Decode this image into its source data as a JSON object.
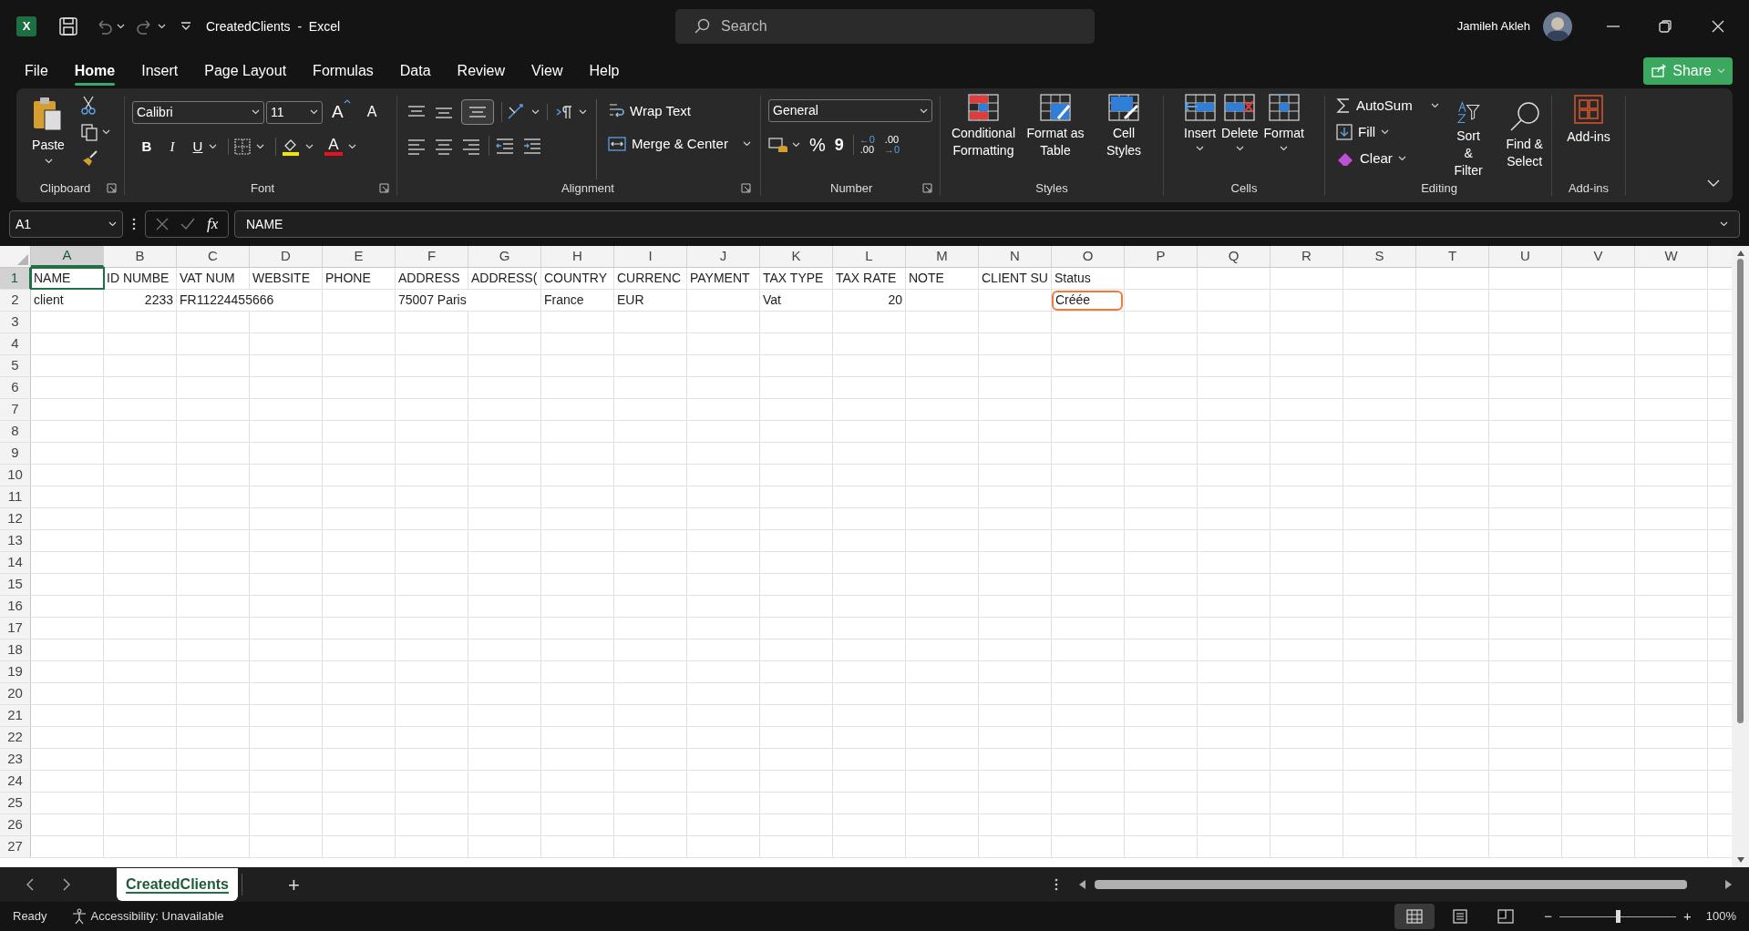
{
  "window": {
    "logo_letter": "X",
    "title": "CreatedClients  -  Excel",
    "search_placeholder": "Search",
    "user": "Jamileh Akleh"
  },
  "menu_tabs": [
    {
      "label": "File",
      "selected": false
    },
    {
      "label": "Home",
      "selected": true
    },
    {
      "label": "Insert",
      "selected": false
    },
    {
      "label": "Page Layout",
      "selected": false
    },
    {
      "label": "Formulas",
      "selected": false
    },
    {
      "label": "Data",
      "selected": false
    },
    {
      "label": "Review",
      "selected": false
    },
    {
      "label": "View",
      "selected": false
    },
    {
      "label": "Help",
      "selected": false
    }
  ],
  "share": "Share",
  "ribbon": {
    "clipboard": {
      "paste": "Paste",
      "group": "Clipboard"
    },
    "font": {
      "family": "Calibri",
      "size": "11",
      "grow": "A",
      "shrink": "A",
      "bold": "B",
      "italic": "I",
      "underline": "U",
      "color_letter": "A",
      "group": "Font"
    },
    "alignment": {
      "wrap": "Wrap Text",
      "merge": "Merge & Center",
      "group": "Alignment"
    },
    "number": {
      "format": "General",
      "percent": "%",
      "comma": "9",
      "inc_top": "←0",
      "inc_bottom": ".00",
      "dec_top": ".00",
      "dec_bottom": "→0",
      "group": "Number"
    },
    "styles": {
      "conditional": [
        "Conditional",
        "Formatting"
      ],
      "table": [
        "Format as",
        "Table"
      ],
      "cell": [
        "Cell",
        "Styles"
      ],
      "group": "Styles"
    },
    "cells": {
      "insert": "Insert",
      "delete": "Delete",
      "format": "Format",
      "group": "Cells"
    },
    "editing": {
      "autosum": "AutoSum",
      "fill": "Fill",
      "clear": "Clear",
      "sort": [
        "Sort &",
        "Filter"
      ],
      "find": [
        "Find &",
        "Select"
      ],
      "group": "Editing"
    },
    "addins": {
      "button": "Add-ins",
      "group": "Add-ins"
    }
  },
  "formula_bar": {
    "name_box": "A1",
    "fx": "fx",
    "formula": "NAME"
  },
  "columns": [
    {
      "label": "A",
      "selected": true
    },
    {
      "label": "B",
      "selected": false
    },
    {
      "label": "C",
      "selected": false
    },
    {
      "label": "D",
      "selected": false
    },
    {
      "label": "E",
      "selected": false
    },
    {
      "label": "F",
      "selected": false
    },
    {
      "label": "G",
      "selected": false
    },
    {
      "label": "H",
      "selected": false
    },
    {
      "label": "I",
      "selected": false
    },
    {
      "label": "J",
      "selected": false
    },
    {
      "label": "K",
      "selected": false
    },
    {
      "label": "L",
      "selected": false
    },
    {
      "label": "M",
      "selected": false
    },
    {
      "label": "N",
      "selected": false
    },
    {
      "label": "O",
      "selected": false
    },
    {
      "label": "P",
      "selected": false
    },
    {
      "label": "Q",
      "selected": false
    },
    {
      "label": "R",
      "selected": false
    },
    {
      "label": "S",
      "selected": false
    },
    {
      "label": "T",
      "selected": false
    },
    {
      "label": "U",
      "selected": false
    },
    {
      "label": "V",
      "selected": false
    },
    {
      "label": "W",
      "selected": false
    }
  ],
  "rows": [
    {
      "number": "1",
      "selected": true,
      "cells": [
        {
          "text": "NAME",
          "selected": true,
          "circled": false
        },
        {
          "text": "ID NUMBE",
          "selected": false,
          "circled": false
        },
        {
          "text": "VAT NUM",
          "selected": false,
          "circled": false
        },
        {
          "text": "WEBSITE",
          "selected": false,
          "circled": false
        },
        {
          "text": "PHONE",
          "selected": false,
          "circled": false
        },
        {
          "text": "ADDRESS",
          "selected": false,
          "circled": false
        },
        {
          "text": "ADDRESS(",
          "selected": false,
          "circled": false
        },
        {
          "text": "COUNTRY",
          "selected": false,
          "circled": false
        },
        {
          "text": "CURRENC",
          "selected": false,
          "circled": false
        },
        {
          "text": "PAYMENT",
          "selected": false,
          "circled": false
        },
        {
          "text": "TAX TYPE",
          "selected": false,
          "circled": false
        },
        {
          "text": "TAX RATE",
          "selected": false,
          "circled": false
        },
        {
          "text": "NOTE",
          "selected": false,
          "circled": false
        },
        {
          "text": "CLIENT SU",
          "selected": false,
          "circled": false
        },
        {
          "text": "Status",
          "selected": false,
          "circled": false
        }
      ]
    },
    {
      "number": "2",
      "selected": false,
      "cells": [
        {
          "text": "client",
          "selected": false,
          "circled": false
        },
        {
          "text": "2233",
          "kind": "number",
          "selected": false,
          "circled": false
        },
        {
          "text": "FR11224455666",
          "selected": false,
          "circled": false
        },
        null,
        null,
        {
          "text": "75007 Paris",
          "selected": false,
          "circled": false
        },
        null,
        {
          "text": "France",
          "selected": false,
          "circled": false
        },
        {
          "text": "EUR",
          "selected": false,
          "circled": false
        },
        null,
        {
          "text": "Vat",
          "selected": false,
          "circled": false
        },
        {
          "text": "20",
          "kind": "number",
          "selected": false,
          "circled": false
        },
        null,
        null,
        {
          "text": "Créée",
          "selected": false,
          "circled": true
        }
      ]
    },
    {
      "number": "3",
      "selected": false
    },
    {
      "number": "4",
      "selected": false
    },
    {
      "number": "5",
      "selected": false
    },
    {
      "number": "6",
      "selected": false
    },
    {
      "number": "7",
      "selected": false
    },
    {
      "number": "8",
      "selected": false
    },
    {
      "number": "9",
      "selected": false
    },
    {
      "number": "10",
      "selected": false
    },
    {
      "number": "11",
      "selected": false
    },
    {
      "number": "12",
      "selected": false
    },
    {
      "number": "13",
      "selected": false
    },
    {
      "number": "14",
      "selected": false
    },
    {
      "number": "15",
      "selected": false
    },
    {
      "number": "16",
      "selected": false
    },
    {
      "number": "17",
      "selected": false
    },
    {
      "number": "18",
      "selected": false
    },
    {
      "number": "19",
      "selected": false
    },
    {
      "number": "20",
      "selected": false
    },
    {
      "number": "21",
      "selected": false
    },
    {
      "number": "22",
      "selected": false
    },
    {
      "number": "23",
      "selected": false
    },
    {
      "number": "24",
      "selected": false
    },
    {
      "number": "25",
      "selected": false
    },
    {
      "number": "26",
      "selected": false
    },
    {
      "number": "27",
      "selected": false
    }
  ],
  "sheet_tabs": [
    {
      "label": "CreatedClients",
      "selected": true
    }
  ],
  "add_sheet": "+",
  "status_bar": {
    "ready": "Ready",
    "accessibility": "Accessibility: Unavailable",
    "zoom_out": "−",
    "zoom_in": "+",
    "zoom": "100%",
    "zoom_level": {
      "level": 0.5
    },
    "views": [
      {
        "selected": true
      },
      {
        "selected": false
      },
      {
        "selected": false
      }
    ]
  }
}
